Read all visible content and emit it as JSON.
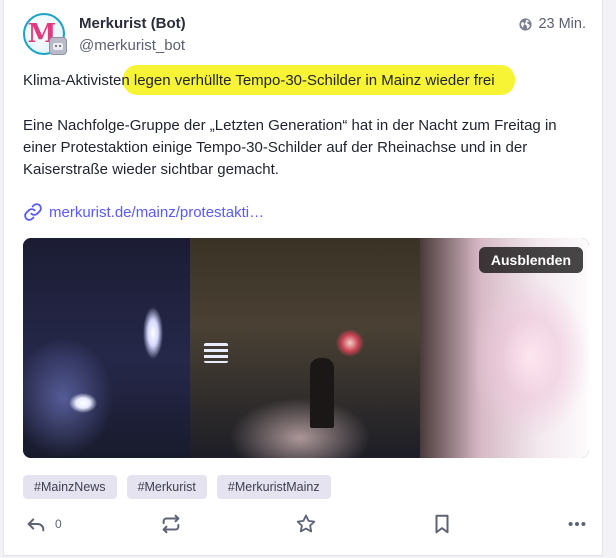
{
  "author": {
    "display_name": "Merkurist (Bot)",
    "handle": "@merkurist_bot",
    "avatar_letter": "M"
  },
  "meta": {
    "time": "23 Min.",
    "visibility_icon": "globe-icon"
  },
  "post": {
    "headline_pre": "Klima-Aktivisten ",
    "headline_highlight": "legen verhüllte Tempo-30-Schilder in Mainz wieder frei",
    "paragraph": "Eine Nachfolge-Gruppe der „Letzten Generation“ hat in der Nacht zum Freitag in einer Protestaktion einige Tempo-30-Schilder auf der Rheinachse und in der Kaiserstraße wieder sichtbar gemacht.",
    "link_text": "merkurist.de/mainz/protestakti…",
    "highlight_color": "#f7f335"
  },
  "media": {
    "hide_label": "Ausblenden"
  },
  "hashtags": [
    "#MainzNews",
    "#Merkurist",
    "#MerkuristMainz"
  ],
  "actions": {
    "reply_count": "0"
  },
  "colors": {
    "accent": "#595aff",
    "avatar_border": "#1ba3c6"
  }
}
